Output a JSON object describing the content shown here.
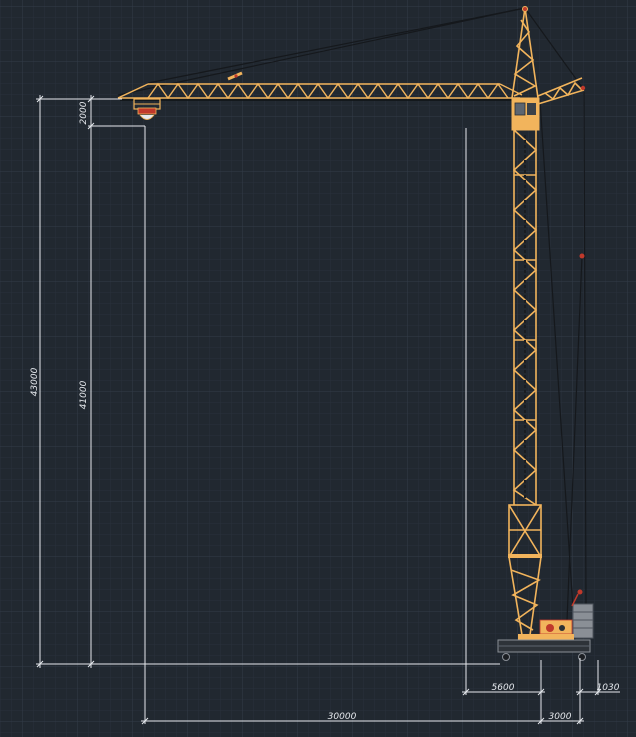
{
  "dimensions": {
    "total_height": "43000",
    "hook_height": "41000",
    "hook_offset": "2000",
    "base_width": "5600",
    "outrigger": "1030",
    "reach": "30000",
    "counter_jib": "3000"
  },
  "colors": {
    "background": "#212830",
    "grid_minor": "#29313b",
    "grid_major": "#323b47",
    "steel": "#f2b45c",
    "dim_lines": "#e6e9ee",
    "cable": "#1b1e22",
    "accent_red": "#c0392b",
    "machinery_grey": "#8a8f96"
  }
}
